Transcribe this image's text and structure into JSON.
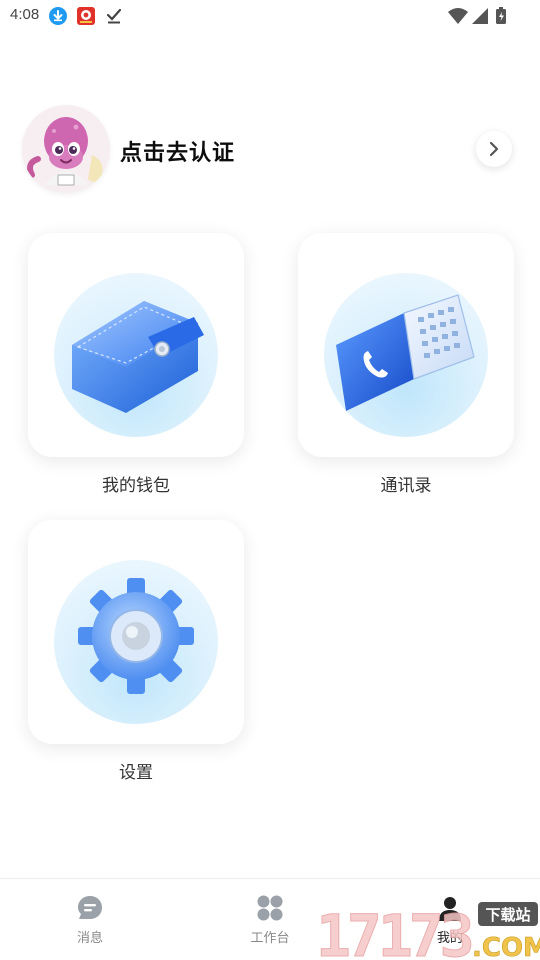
{
  "status_bar": {
    "time": "4:08",
    "left_icons": [
      "download-icon",
      "app-notification-icon",
      "done-check-icon"
    ],
    "right_icons": [
      "wifi-icon",
      "signal-icon",
      "battery-charging-icon"
    ]
  },
  "profile": {
    "name": "点击去认证",
    "avatar": "octopus-mascot-avatar"
  },
  "tiles": [
    {
      "label": "我的钱包",
      "icon": "wallet-icon"
    },
    {
      "label": "通讯录",
      "icon": "address-book-icon"
    },
    {
      "label": "设置",
      "icon": "settings-gear-icon"
    }
  ],
  "bottom_nav": [
    {
      "label": "消息",
      "icon": "message-icon",
      "active": false
    },
    {
      "label": "工作台",
      "icon": "workbench-grid-icon",
      "active": false
    },
    {
      "label": "我的",
      "icon": "me-icon",
      "active": true
    }
  ],
  "watermark": {
    "digits": "17173",
    "domain": ".COM",
    "tag": "下载站"
  },
  "colors": {
    "accent_blue": "#2f6fe0",
    "tile_glow": "#bfe6fb",
    "nav_inactive": "#888888",
    "title_text": "#0d0d0d"
  }
}
